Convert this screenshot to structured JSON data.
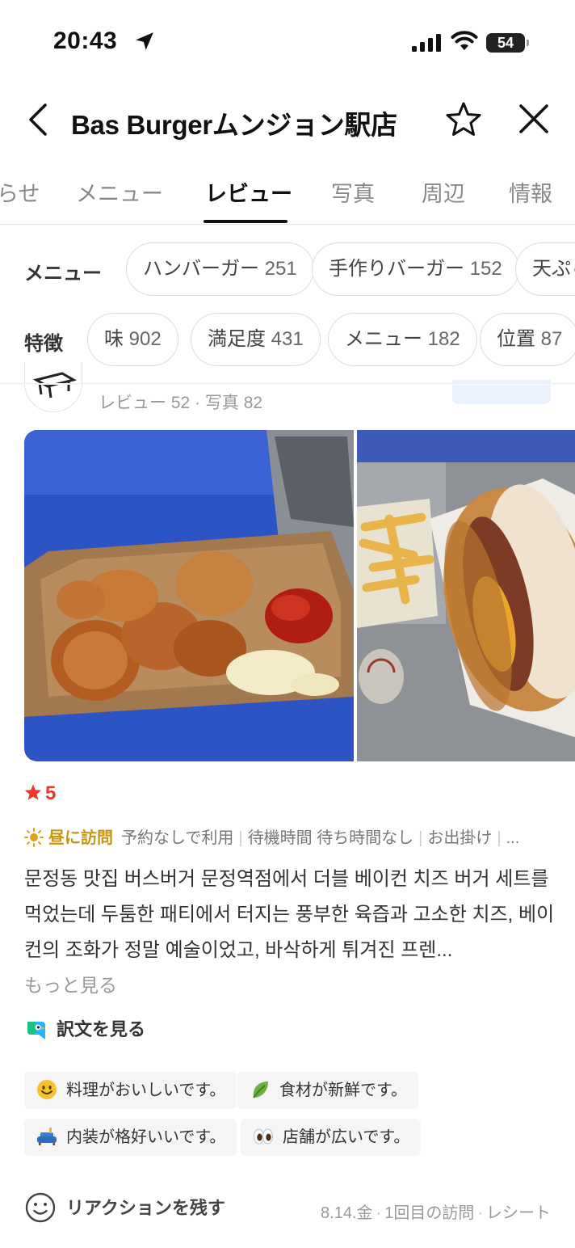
{
  "status_bar": {
    "time": "20:43",
    "battery": "54"
  },
  "header": {
    "title": "Bas Burgerムンジョン駅店"
  },
  "tabs": [
    {
      "label": "らせ",
      "active": false
    },
    {
      "label": "メニュー",
      "active": false
    },
    {
      "label": "レビュー",
      "active": true
    },
    {
      "label": "写真",
      "active": false
    },
    {
      "label": "周辺",
      "active": false
    },
    {
      "label": "情報",
      "active": false
    }
  ],
  "menu_filter": {
    "label": "メニュー",
    "chips": [
      {
        "name": "ハンバーガー",
        "count": "251"
      },
      {
        "name": "手作りバーガー",
        "count": "152"
      },
      {
        "name": "天ぷら",
        "count": ""
      }
    ]
  },
  "feature_filter": {
    "label": "特徴",
    "chips": [
      {
        "name": "味",
        "count": "902"
      },
      {
        "name": "満足度",
        "count": "431"
      },
      {
        "name": "メニュー",
        "count": "182"
      },
      {
        "name": "位置",
        "count": "87"
      }
    ]
  },
  "reviewer": {
    "meta": "レビュー 52 · 写真 82"
  },
  "review": {
    "rating": "5",
    "visit_time": "昼に訪問",
    "visit_details": [
      "予約なしで利用",
      "待機時間 待ち時間なし",
      "お出掛け",
      "..."
    ],
    "text": "문정동 맛집 버스버거 문정역점에서 더블 베이컨 치즈 버거 세트를 먹었는데 두툼한 패티에서 터지는 풍부한 육즙과 고소한 치즈, 베이컨의 조화가 정말 예술이었고, 바삭하게 튀겨진 프렌...",
    "more_label": "もっと見る",
    "translate_label": "訳文を見る",
    "tags": [
      {
        "icon": "smile-emoji-icon",
        "label": "料理がおいしいです。"
      },
      {
        "icon": "leaf-emoji-icon",
        "label": "食材が新鮮です。"
      },
      {
        "icon": "sofa-emoji-icon",
        "label": "内装が格好いいです。"
      },
      {
        "icon": "eyes-emoji-icon",
        "label": "店舗が広いです。"
      }
    ]
  },
  "footer": {
    "reaction_label": "リアクションを残す",
    "date": "8.14.金",
    "visit_count": "1回目の訪問",
    "receipt": "レシート"
  },
  "colors": {
    "rating_red": "#e8392d",
    "visit_gold": "#c89411",
    "tab_active": "#111111"
  }
}
